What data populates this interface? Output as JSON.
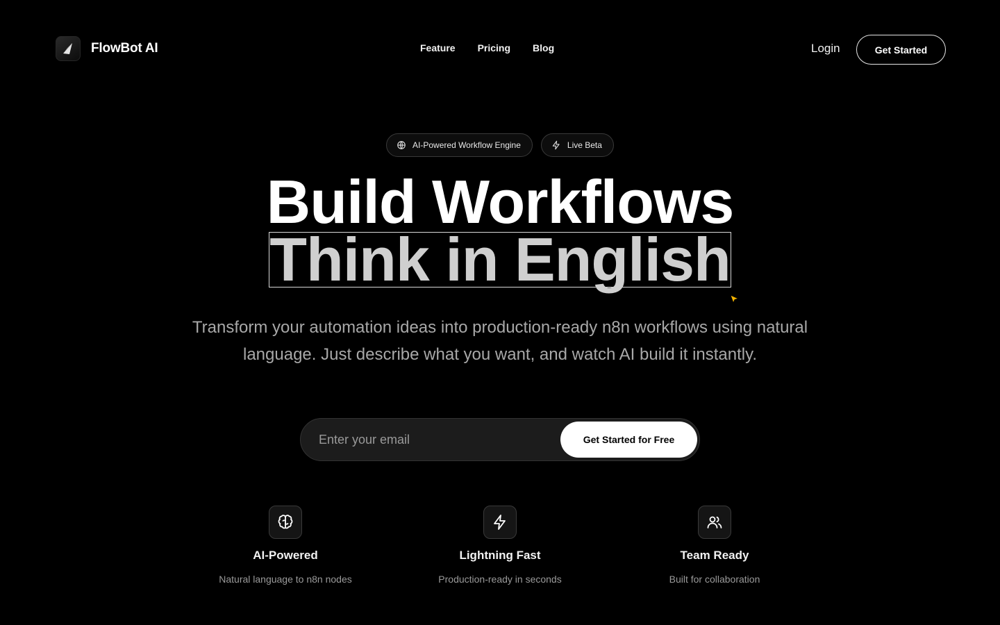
{
  "header": {
    "brand": "FlowBot AI",
    "nav": [
      "Feature",
      "Pricing",
      "Blog"
    ],
    "login_label": "Login",
    "cta_label": "Get Started"
  },
  "badges": [
    {
      "icon": "globe-icon",
      "label": "AI-Powered Workflow Engine"
    },
    {
      "icon": "zap-icon",
      "label": "Live Beta"
    }
  ],
  "hero": {
    "line1": "Build Workflows",
    "line2": "Think in English",
    "subtitle": "Transform your automation ideas into production-ready n8n workflows using natural language. Just describe what you want, and watch AI build it instantly."
  },
  "signup": {
    "placeholder": "Enter your email",
    "value": "",
    "button_label": "Get Started for Free"
  },
  "features": [
    {
      "icon": "brain-icon",
      "title": "AI-Powered",
      "desc": "Natural language to n8n nodes"
    },
    {
      "icon": "zap-icon",
      "title": "Lightning Fast",
      "desc": "Production-ready in seconds"
    },
    {
      "icon": "users-icon",
      "title": "Team Ready",
      "desc": "Built for collaboration"
    }
  ],
  "colors": {
    "background": "#000000",
    "text_primary": "#ffffff",
    "text_muted": "#a8a8a8",
    "cursor_accent": "#f5b400"
  }
}
